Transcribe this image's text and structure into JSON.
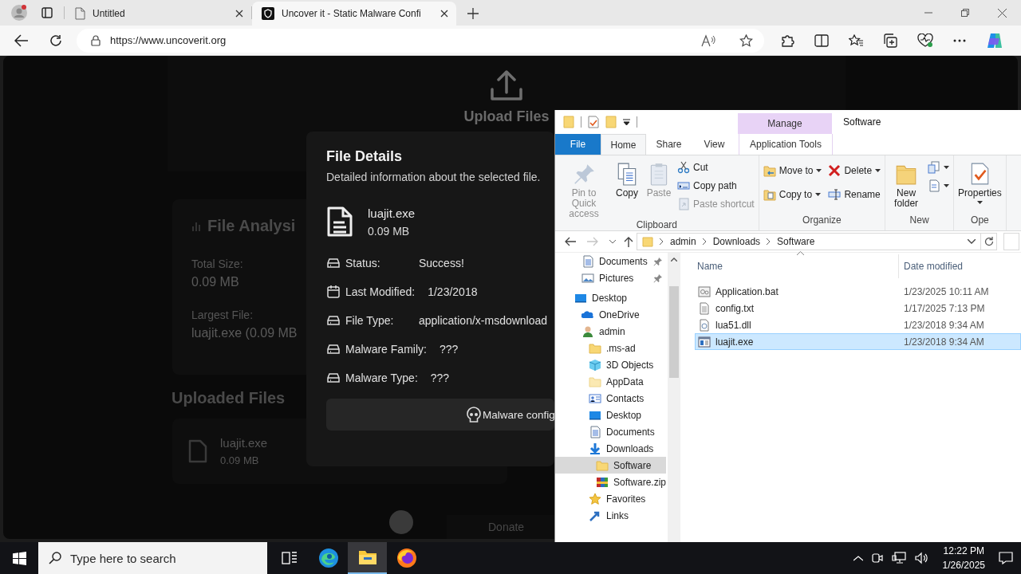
{
  "browser": {
    "tabs": [
      {
        "title": "Untitled",
        "selected": false
      },
      {
        "title": "Uncover it - Static Malware Confi",
        "selected": true
      }
    ],
    "url": "https://www.uncoverit.org"
  },
  "page": {
    "upload_title": "Upload Files",
    "analysis": {
      "title": "File Analysi",
      "stats": [
        {
          "label": "Total Size:",
          "value": "0.09 MB"
        },
        {
          "label": "Largest File:",
          "value": "luajit.exe (0.09 MB"
        }
      ]
    },
    "uploaded": {
      "title": "Uploaded Files",
      "files": [
        {
          "name": "luajit.exe",
          "size": "0.09 MB"
        }
      ]
    },
    "donate": "Donate"
  },
  "modal": {
    "title": "File Details",
    "subtitle": "Detailed information about the selected file.",
    "file": {
      "name": "luajit.exe",
      "size": "0.09 MB"
    },
    "fields": [
      {
        "kind": "drive",
        "label": "Status:",
        "value": "Success!"
      },
      {
        "kind": "calendar",
        "label": "Last Modified:",
        "value": "1/23/2018"
      },
      {
        "kind": "drive",
        "label": "File Type:",
        "value": "application/x-msdownload"
      },
      {
        "kind": "drive",
        "label": "Malware Family:",
        "value": "???"
      },
      {
        "kind": "drive",
        "label": "Malware Type:",
        "value": "???"
      }
    ],
    "button": "Malware config"
  },
  "explorer": {
    "context_header": "Manage",
    "title": "Software",
    "tabs": [
      {
        "kind": "file",
        "label": "File",
        "selected": false
      },
      {
        "kind": "tab",
        "label": "Home",
        "selected": true
      },
      {
        "kind": "tab",
        "label": "Share",
        "selected": false
      },
      {
        "kind": "tab",
        "label": "View",
        "selected": false
      },
      {
        "kind": "context",
        "label": "Application Tools",
        "selected": false
      }
    ],
    "groups": [
      {
        "label": "Clipboard",
        "columns": [
          [
            {
              "kind": "large",
              "label": "Pin to Quick access",
              "disabled": true,
              "dropdown": false
            }
          ],
          [
            {
              "kind": "large",
              "label": "Copy",
              "disabled": false,
              "dropdown": false
            }
          ],
          [
            {
              "kind": "large",
              "label": "Paste",
              "disabled": true,
              "dropdown": false
            }
          ],
          [
            {
              "kind": "small",
              "label": "Cut",
              "disabled": false,
              "dropdown": false
            },
            {
              "kind": "small",
              "label": "Copy path",
              "disabled": false,
              "dropdown": false
            },
            {
              "kind": "small",
              "label": "Paste shortcut",
              "disabled": true,
              "dropdown": false
            }
          ]
        ]
      },
      {
        "label": "Organize",
        "columns": [
          [
            {
              "kind": "small",
              "label": "Move to",
              "disabled": false,
              "dropdown": true
            },
            {
              "kind": "small",
              "label": "Copy to",
              "disabled": false,
              "dropdown": true
            }
          ],
          [
            {
              "kind": "small",
              "label": "Delete",
              "disabled": false,
              "dropdown": true
            },
            {
              "kind": "small",
              "label": "Rename",
              "disabled": false,
              "dropdown": false
            }
          ]
        ]
      },
      {
        "label": "New",
        "columns": [
          [
            {
              "kind": "large",
              "label": "New folder",
              "disabled": false,
              "dropdown": false
            }
          ],
          [
            {
              "kind": "icon",
              "disabled": false,
              "dropdown": true
            },
            {
              "kind": "icon",
              "disabled": false,
              "dropdown": true
            }
          ]
        ]
      },
      {
        "label": "Ope",
        "columns": [
          [
            {
              "kind": "large",
              "label": "Properties",
              "disabled": false,
              "dropdown": true
            }
          ]
        ]
      }
    ],
    "path": [
      "admin",
      "Downloads",
      "Software"
    ],
    "quick_access": [
      {
        "label": "Documents",
        "kind": "documents",
        "pinned": true
      },
      {
        "label": "Pictures",
        "kind": "pictures",
        "pinned": true
      }
    ],
    "tree": [
      {
        "label": "Desktop",
        "kind": "desktop",
        "selected": false,
        "children": [
          {
            "label": "OneDrive",
            "kind": "onedrive",
            "selected": false
          },
          {
            "label": "admin",
            "kind": "user",
            "selected": false,
            "children": [
              {
                "label": ".ms-ad",
                "kind": "folder",
                "selected": false
              },
              {
                "label": "3D Objects",
                "kind": "objects",
                "selected": false
              },
              {
                "label": "AppData",
                "kind": "folder-light",
                "selected": false
              },
              {
                "label": "Contacts",
                "kind": "contacts",
                "selected": false
              },
              {
                "label": "Desktop",
                "kind": "desktop",
                "selected": false
              },
              {
                "label": "Documents",
                "kind": "documents",
                "selected": false
              },
              {
                "label": "Downloads",
                "kind": "downloads",
                "selected": false,
                "children": [
                  {
                    "label": "Software",
                    "kind": "folder",
                    "selected": true
                  },
                  {
                    "label": "Software.zip",
                    "kind": "archive",
                    "selected": false
                  }
                ]
              },
              {
                "label": "Favorites",
                "kind": "favorites",
                "selected": false
              },
              {
                "label": "Links",
                "kind": "links",
                "selected": false
              }
            ]
          }
        ]
      }
    ],
    "columns": [
      "Name",
      "Date modified"
    ],
    "files": [
      {
        "name": "Application.bat",
        "date": "1/23/2025 10:11 AM",
        "kind": "batch",
        "selected": false
      },
      {
        "name": "config.txt",
        "date": "1/17/2025 7:13 PM",
        "kind": "text",
        "selected": false
      },
      {
        "name": "lua51.dll",
        "date": "1/23/2018 9:34 AM",
        "kind": "library",
        "selected": false
      },
      {
        "name": "luajit.exe",
        "date": "1/23/2018 9:34 AM",
        "kind": "program",
        "selected": true
      }
    ]
  },
  "taskbar": {
    "search_placeholder": "Type here to search",
    "apps": [
      {
        "kind": "taskview",
        "active": false
      },
      {
        "kind": "edge",
        "active": false
      },
      {
        "kind": "explorer",
        "active": true
      },
      {
        "kind": "firefox",
        "active": false
      }
    ],
    "time": "12:22 PM",
    "date": "1/26/2025"
  }
}
